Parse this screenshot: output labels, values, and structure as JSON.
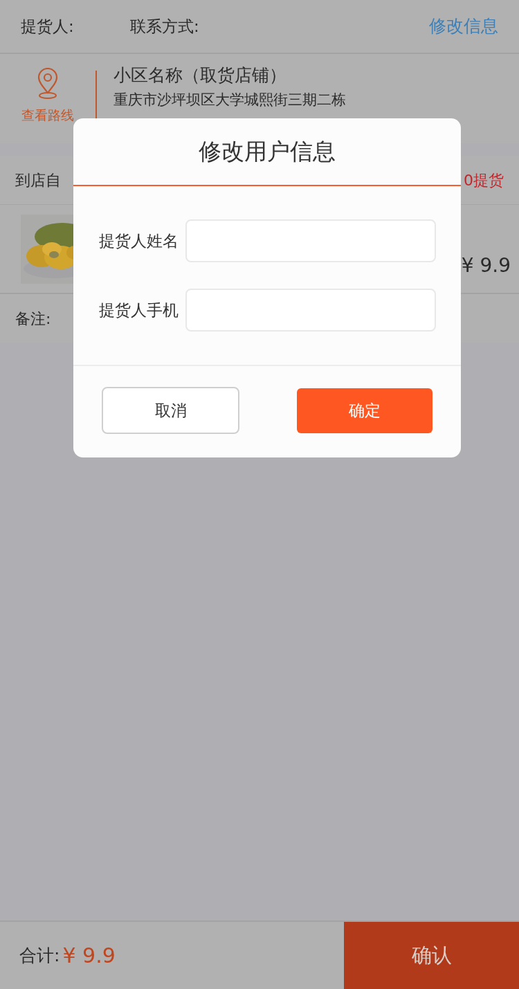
{
  "header": {
    "pickup_label": "提货人:",
    "contact_label": "联系方式:",
    "edit_link": "修改信息"
  },
  "store": {
    "route_label": "查看路线",
    "name": "小区名称（取货店铺）",
    "address": "重庆市沙坪坝区大学城熙街三期二栋"
  },
  "pickup_row": {
    "mode": "到店自",
    "time": "0提货"
  },
  "product": {
    "price": "¥ 9.9"
  },
  "remark": {
    "label": "备注:"
  },
  "footer": {
    "total_label": "合计:",
    "total_value": "¥ 9.9",
    "confirm": "确认"
  },
  "dialog": {
    "title": "修改用户信息",
    "fields": [
      {
        "label": "提货人姓名"
      },
      {
        "label": "提货人手机"
      }
    ],
    "buttons": [
      {
        "label": "取消",
        "kind": "cancel"
      },
      {
        "label": "确定",
        "kind": "primary"
      }
    ]
  }
}
